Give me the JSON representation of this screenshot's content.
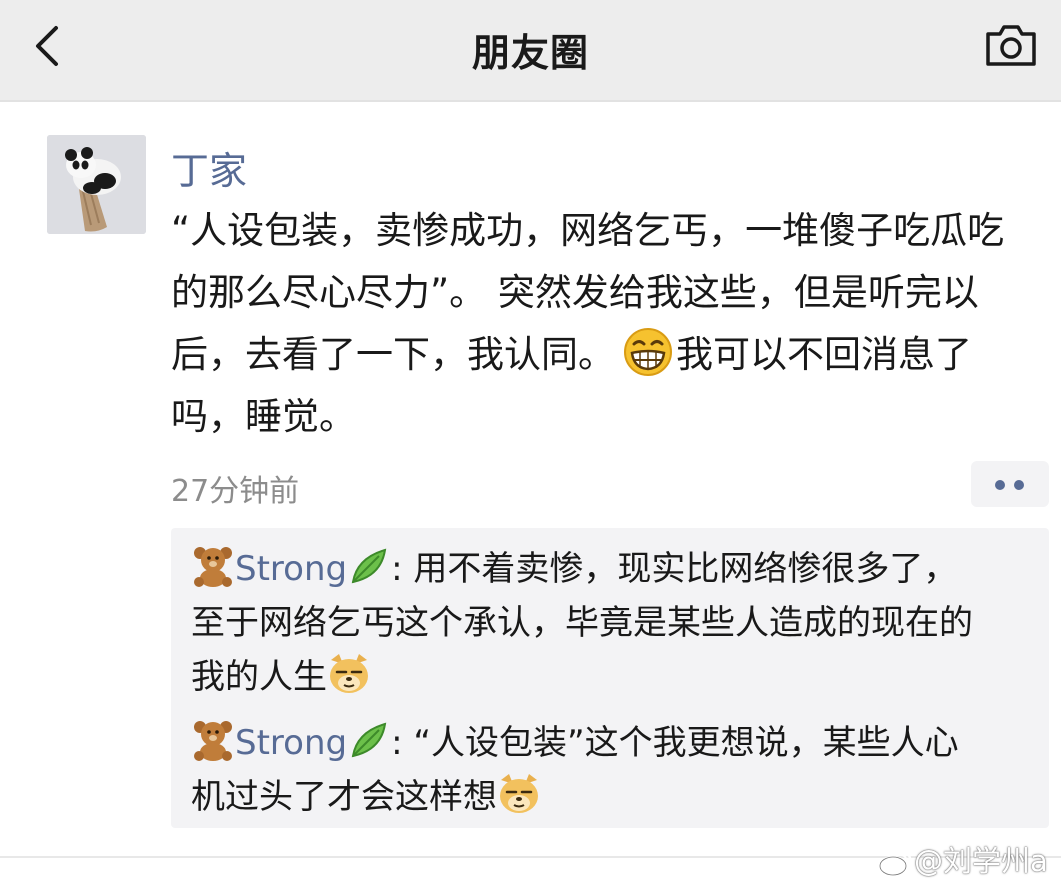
{
  "header": {
    "title": "朋友圈",
    "back_icon": "chevron-left-icon",
    "camera_icon": "camera-icon"
  },
  "post": {
    "author": "丁家",
    "text_part1": "“人设包装，卖惨成功，网络乞丐，一堆傻子吃瓜吃的那么尽心尽力”。 突然发给我这些，但是听完以后，去看了一下，我认同。",
    "text_part2": "我可以不回消息了吗，睡觉。",
    "timestamp": "27分钟前"
  },
  "comments": [
    {
      "author": "Strong",
      "separator": ":",
      "text_line1": "用不着卖惨，现实比网络惨很多了，",
      "text_line2": "至于网络乞丐这个承认，毕竟是某些人造成的现在的",
      "text_line3": "我的人生"
    },
    {
      "author": "Strong",
      "separator": ":",
      "text_line1": "“人设包装”这个我更想说，某些人心",
      "text_line2": "机过头了才会这样想"
    }
  ],
  "watermark": "@刘学州a",
  "colors": {
    "link_blue": "#576b95",
    "header_bg": "#ededed",
    "comment_bg": "#f3f3f5",
    "text": "#191919",
    "secondary_text": "#8c8c8c"
  }
}
